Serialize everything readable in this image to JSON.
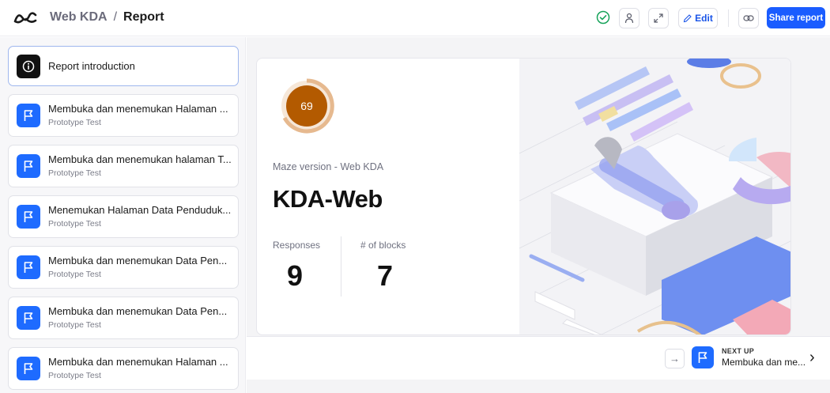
{
  "header": {
    "breadcrumb_root": "Web KDA",
    "breadcrumb_sep": "/",
    "breadcrumb_current": "Report",
    "edit_label": "Edit",
    "share_label": "Share report"
  },
  "sidebar": {
    "items": [
      {
        "title": "Report introduction",
        "subtitle": "",
        "icon": "info-icon",
        "active": true
      },
      {
        "title": "Membuka dan menemukan Halaman ...",
        "subtitle": "Prototype Test",
        "icon": "flag-icon"
      },
      {
        "title": "Membuka dan menemukan halaman T...",
        "subtitle": "Prototype Test",
        "icon": "flag-icon"
      },
      {
        "title": "Menemukan Halaman Data Penduduk...",
        "subtitle": "Prototype Test",
        "icon": "flag-icon"
      },
      {
        "title": "Membuka dan menemukan Data Pen...",
        "subtitle": "Prototype Test",
        "icon": "flag-icon"
      },
      {
        "title": "Membuka dan menemukan Data Pen...",
        "subtitle": "Prototype Test",
        "icon": "flag-icon"
      },
      {
        "title": "Membuka dan menemukan Halaman ...",
        "subtitle": "Prototype Test",
        "icon": "flag-icon"
      }
    ]
  },
  "report": {
    "score": "69",
    "version": "Maze version - Web KDA",
    "title": "KDA-Web",
    "responses_label": "Responses",
    "responses_value": "9",
    "blocks_label": "# of blocks",
    "blocks_value": "7"
  },
  "footer": {
    "next_label": "NEXT UP",
    "next_title": "Membuka dan me..."
  },
  "colors": {
    "accent": "#1a5cff",
    "score_ring": "#b35a00",
    "icon_blue": "#1e6bff"
  }
}
